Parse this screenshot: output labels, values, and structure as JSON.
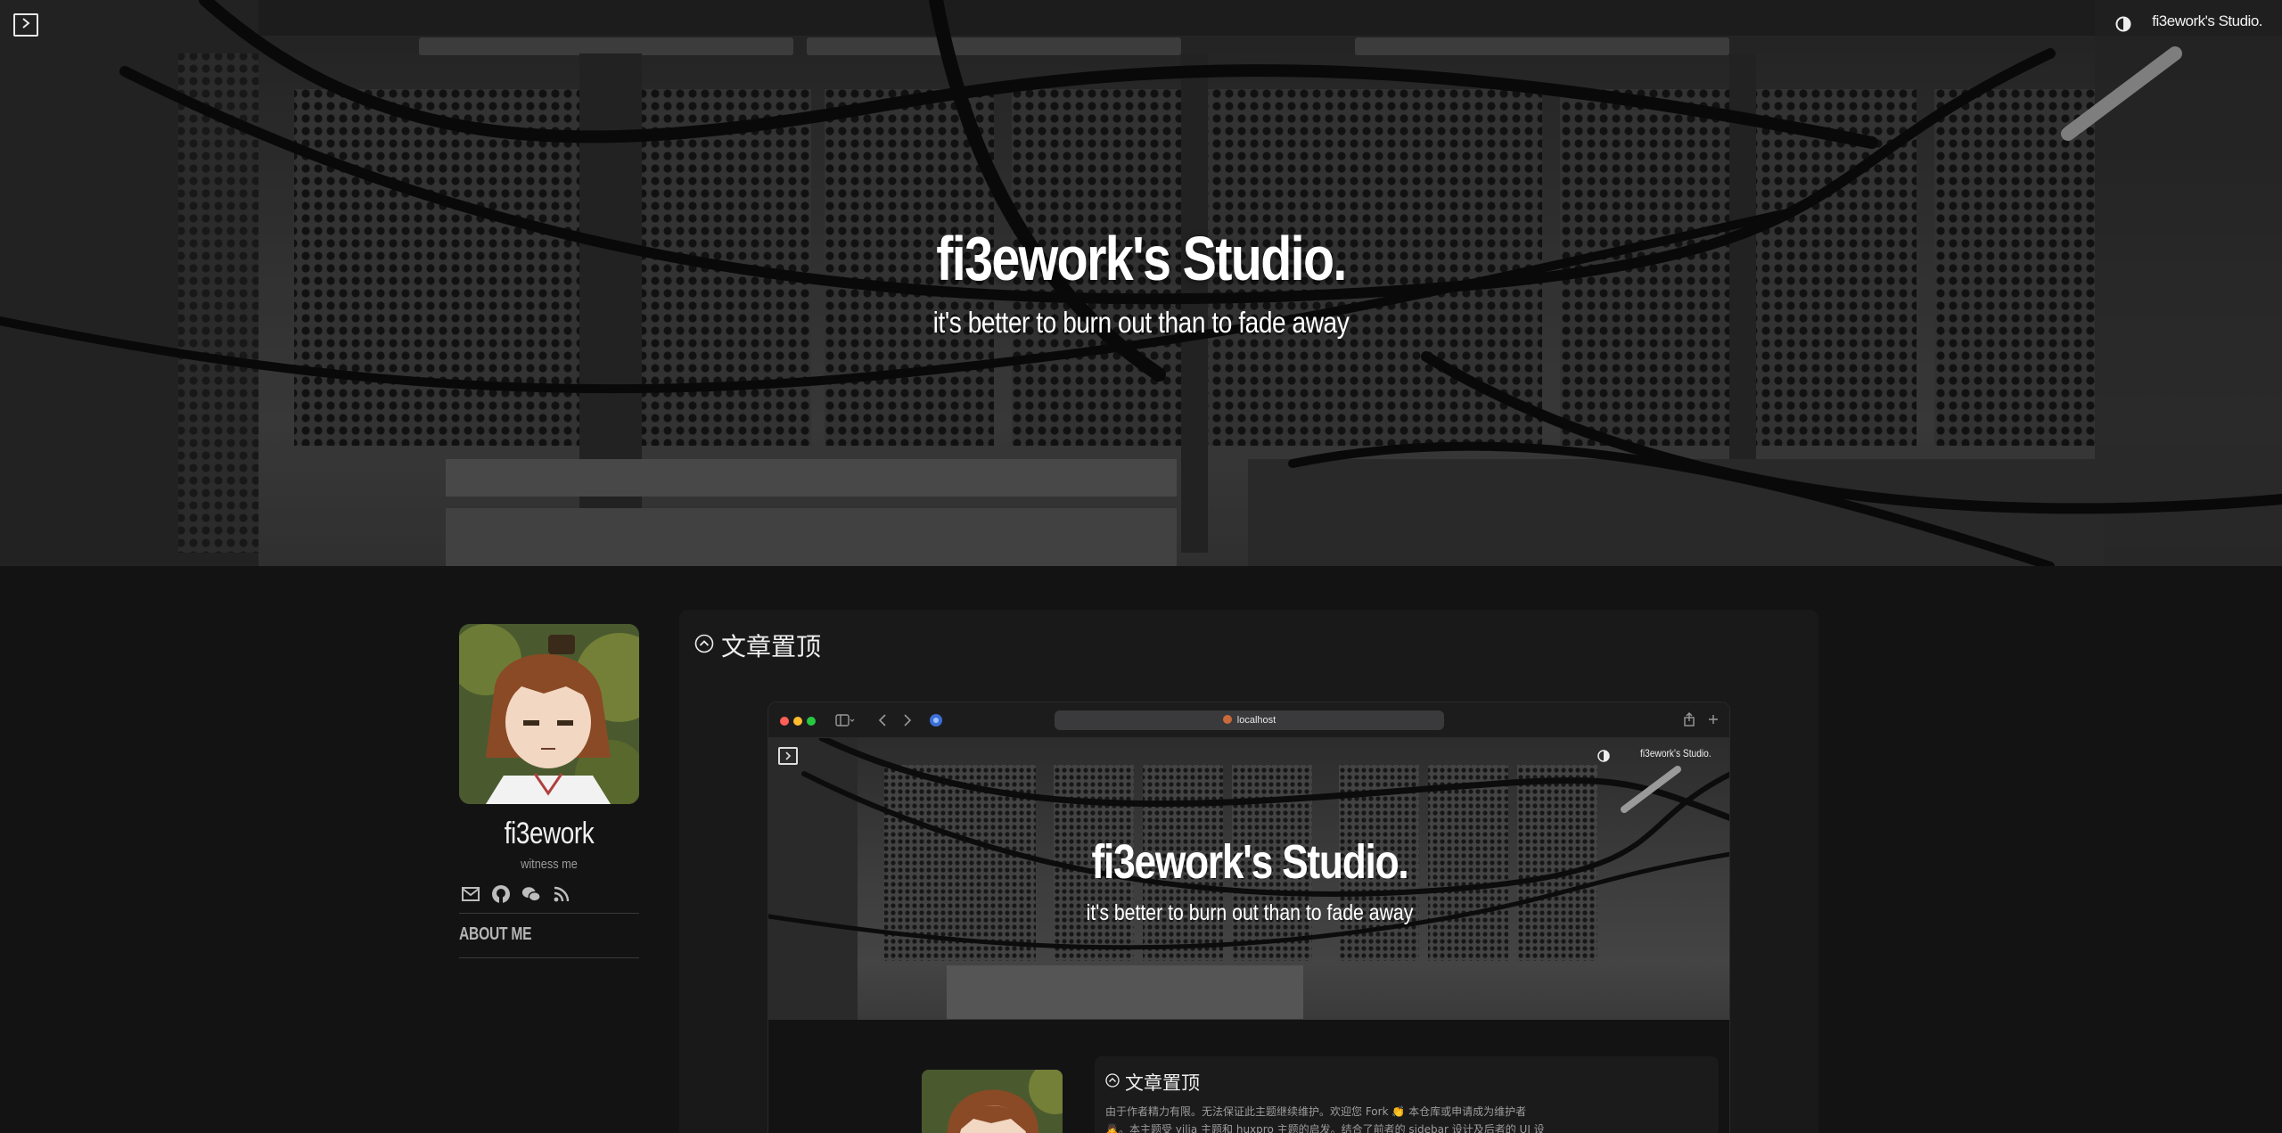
{
  "header": {
    "site_brand": "fi3ework's Studio.",
    "icons": {
      "menu": "chevron-right-box-icon",
      "theme": "half-circle-contrast-icon"
    }
  },
  "hero": {
    "title": "fi3ework's Studio.",
    "subtitle": "it's better to burn out than to fade away"
  },
  "sidebar": {
    "author_name": "fi3ework",
    "author_bio": "witness me",
    "social_icons": [
      "mail-icon",
      "github-icon",
      "wechat-icon",
      "rss-icon"
    ],
    "nav_items": [
      {
        "label": "ABOUT ME"
      }
    ]
  },
  "main": {
    "section_title": "文章置顶",
    "section_icon": "circle-chevron-up-icon",
    "preview": {
      "url": "localhost",
      "site_brand": "fi3ework's Studio.",
      "title": "fi3ework's Studio.",
      "subtitle": "it's better to burn out than to fade away",
      "section_title": "文章置顶",
      "excerpt_line1": "由于作者精力有限。无法保证此主题继续维护。欢迎您 Fork 👏 本仓库或申请成为维护者",
      "excerpt_line2": "🙇。本主题受 yilia 主题和 huxpro 主题的启发。结合了前者的 sidebar 设计及后者的 UI 设"
    }
  },
  "colors": {
    "page_bg": "#131314",
    "card_bg": "#19191a",
    "text": "#e8e8e8",
    "muted": "#9a9a9a",
    "mac_red": "#ff5f57",
    "mac_yellow": "#febc2e",
    "mac_green": "#28c840"
  }
}
